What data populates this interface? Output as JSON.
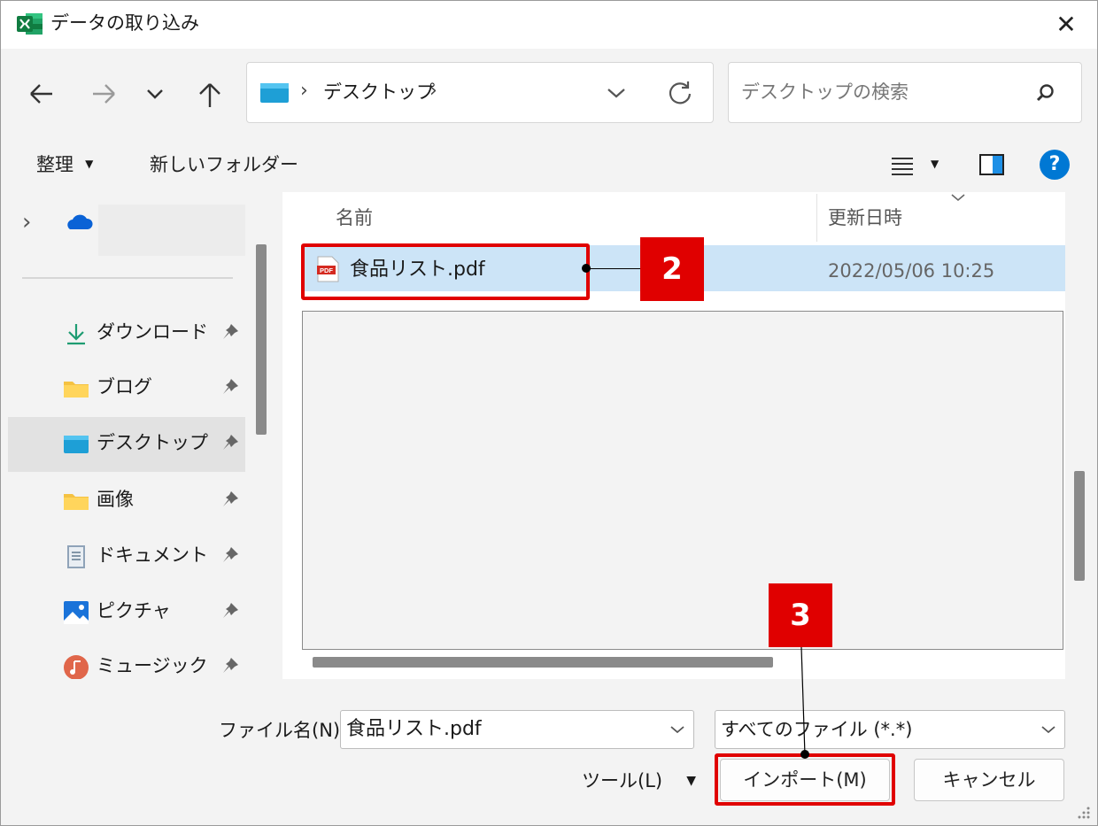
{
  "window": {
    "title": "データの取り込み",
    "app_icon": "excel-icon",
    "close_glyph": "✕"
  },
  "nav": {
    "back_icon": "arrow-left-icon",
    "forward_icon": "arrow-right-icon",
    "recent_icon": "chevron-down-icon",
    "up_icon": "arrow-up-icon",
    "breadcrumb_sep": "›",
    "breadcrumb": [
      "デスクトップ"
    ],
    "search_placeholder": "デスクトップの検索"
  },
  "toolbar": {
    "organize": "整理",
    "new_folder": "新しいフォルダー",
    "help": "?"
  },
  "sidebar": {
    "items": [
      {
        "label": "ダウンロード",
        "icon": "download-icon"
      },
      {
        "label": "ブログ",
        "icon": "folder-icon"
      },
      {
        "label": "デスクトップ",
        "icon": "desktop-icon",
        "selected": true
      },
      {
        "label": "画像",
        "icon": "folder-icon"
      },
      {
        "label": "ドキュメント",
        "icon": "document-icon"
      },
      {
        "label": "ピクチャ",
        "icon": "picture-icon"
      },
      {
        "label": "ミュージック",
        "icon": "music-icon"
      }
    ]
  },
  "filelist": {
    "columns": [
      "名前",
      "更新日時"
    ],
    "rows": [
      {
        "name": "食品リスト.pdf",
        "modified": "2022/05/06 10:25",
        "icon": "pdf-icon",
        "icon_text": "PDF"
      }
    ]
  },
  "bottom": {
    "filename_label": "ファイル名(N):",
    "filename_value": "食品リスト.pdf",
    "filter_value": "すべてのファイル (*.*)",
    "tools_label": "ツール(L)",
    "import_label": "インポート(M)",
    "cancel_label": "キャンセル"
  },
  "annotations": {
    "step2": "2",
    "step3": "3",
    "color": "#e00000"
  },
  "colors": {
    "selection": "#cce4f7",
    "accent": "#0078d4",
    "excel_green": "#107c41"
  }
}
